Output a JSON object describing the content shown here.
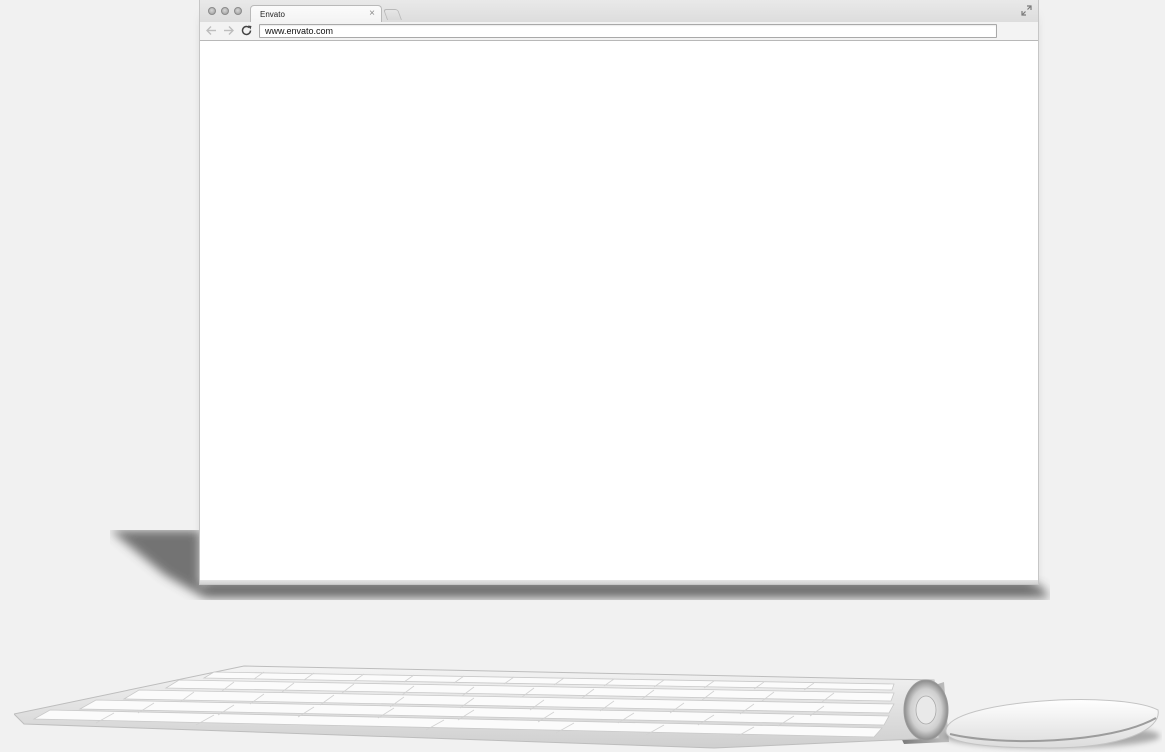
{
  "browser": {
    "tab": {
      "title": "Envato",
      "close_label": "×"
    },
    "address_bar": {
      "url": "www.envato.com"
    },
    "icons": {
      "back": "arrow-left-icon",
      "forward": "arrow-right-icon",
      "reload": "reload-icon",
      "fullscreen": "expand-icon"
    }
  },
  "colors": {
    "background": "#f1f1f1",
    "window_frame": "#e3e3e3",
    "content": "#ffffff"
  }
}
